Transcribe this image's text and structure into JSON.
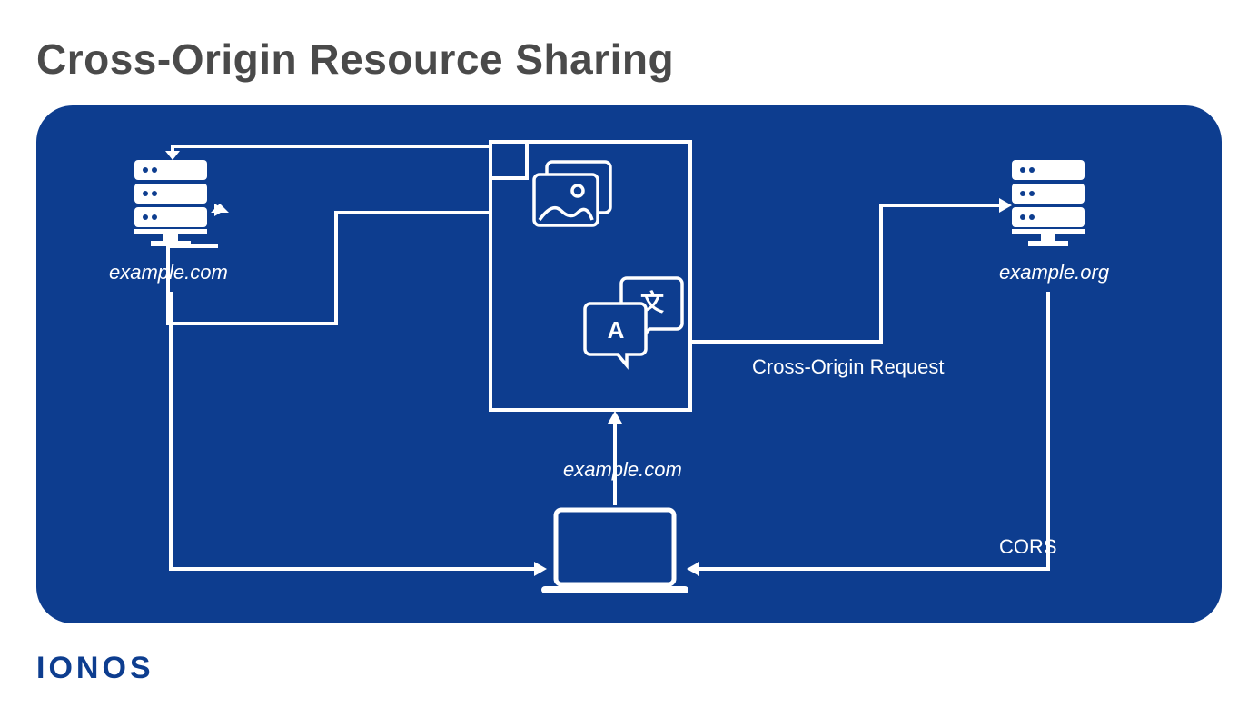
{
  "title": "Cross-Origin Resource Sharing",
  "brand": "IONOS",
  "labels": {
    "server_left": "example.com",
    "server_right": "example.org",
    "request_label": "Cross-Origin Request",
    "center_label": "example.com",
    "cors_label": "CORS"
  },
  "icons": {
    "server_left": "server-icon",
    "server_right": "server-icon",
    "document": "document-icon",
    "images": "images-icon",
    "translate": "translate-icon",
    "laptop": "laptop-icon"
  },
  "translate_glyphs": {
    "a": "A",
    "cjk": "文"
  },
  "colors": {
    "panel": "#0d3d8f",
    "stroke": "#ffffff",
    "title": "#4a4a4a"
  }
}
